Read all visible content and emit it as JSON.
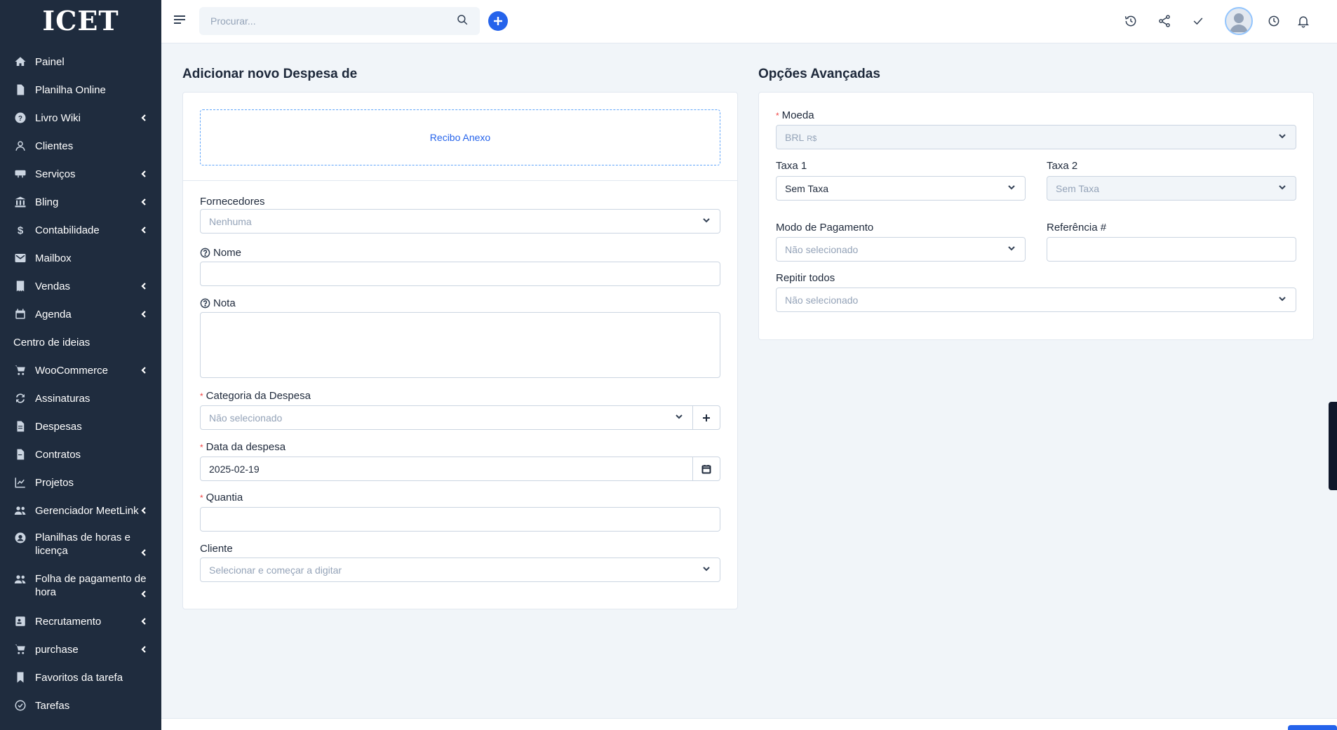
{
  "app": {
    "logo": "ICET"
  },
  "sidebar": {
    "items": [
      {
        "label": "Painel",
        "icon": "home-icon",
        "submenu": false
      },
      {
        "label": "Planilha Online",
        "icon": "file-icon",
        "submenu": false
      },
      {
        "label": "Livro Wiki",
        "icon": "question-icon",
        "submenu": true
      },
      {
        "label": "Clientes",
        "icon": "user-icon",
        "submenu": false
      },
      {
        "label": "Serviços",
        "icon": "ticket-icon",
        "submenu": true
      },
      {
        "label": "Bling",
        "icon": "bank-icon",
        "submenu": true
      },
      {
        "label": "Contabilidade",
        "icon": "dollar-icon",
        "submenu": true
      },
      {
        "label": "Mailbox",
        "icon": "envelope-icon",
        "submenu": false
      },
      {
        "label": "Vendas",
        "icon": "receipt-icon",
        "submenu": true
      },
      {
        "label": "Agenda",
        "icon": "calendar-icon",
        "submenu": true
      },
      {
        "label": "Centro de ideias",
        "icon": "",
        "submenu": false
      },
      {
        "label": "WooCommerce",
        "icon": "cart-icon",
        "submenu": true
      },
      {
        "label": "Assinaturas",
        "icon": "refresh-icon",
        "submenu": false
      },
      {
        "label": "Despesas",
        "icon": "file-text-icon",
        "submenu": false
      },
      {
        "label": "Contratos",
        "icon": "contract-icon",
        "submenu": false
      },
      {
        "label": "Projetos",
        "icon": "chart-icon",
        "submenu": false
      },
      {
        "label": "Gerenciador MeetLink",
        "icon": "users-icon",
        "submenu": true
      },
      {
        "label": "Planilhas de horas e licença",
        "icon": "user-circle-icon",
        "submenu": true
      },
      {
        "label": "Folha de pagamento de hora",
        "icon": "users-icon",
        "submenu": true
      },
      {
        "label": "Recrutamento",
        "icon": "id-card-icon",
        "submenu": true
      },
      {
        "label": "purchase",
        "icon": "cart-icon",
        "submenu": true
      },
      {
        "label": "Favoritos da tarefa",
        "icon": "bookmark-icon",
        "submenu": false
      },
      {
        "label": "Tarefas",
        "icon": "check-circle-icon",
        "submenu": false
      }
    ]
  },
  "header": {
    "search_placeholder": "Procurar..."
  },
  "form": {
    "title": "Adicionar novo Despesa de",
    "receipt_label": "Recibo Anexo",
    "vendor": {
      "label": "Fornecedores",
      "value": "Nenhuma"
    },
    "name": {
      "label": "Nome",
      "value": ""
    },
    "note": {
      "label": "Nota",
      "value": ""
    },
    "category": {
      "label": "Categoria da Despesa",
      "value": "Não selecionado"
    },
    "date": {
      "label": "Data da despesa",
      "value": "2025-02-19"
    },
    "amount": {
      "label": "Quantia",
      "value": ""
    },
    "customer": {
      "label": "Cliente",
      "value": "Selecionar e começar a digitar"
    }
  },
  "advanced": {
    "title": "Opções Avançadas",
    "currency": {
      "label": "Moeda",
      "value": "BRL",
      "symbol": "R$"
    },
    "tax1": {
      "label": "Taxa 1",
      "value": "Sem Taxa"
    },
    "tax2": {
      "label": "Taxa 2",
      "value": "Sem Taxa"
    },
    "payment_mode": {
      "label": "Modo de Pagamento",
      "value": "Não selecionado"
    },
    "reference": {
      "label": "Referência #",
      "value": ""
    },
    "repeat": {
      "label": "Repitir todos",
      "value": "Não selecionado"
    }
  },
  "colors": {
    "sidebar": "#1f2c3e",
    "accent": "#2563eb",
    "background": "#f1f5f9",
    "required": "#ef4444"
  }
}
